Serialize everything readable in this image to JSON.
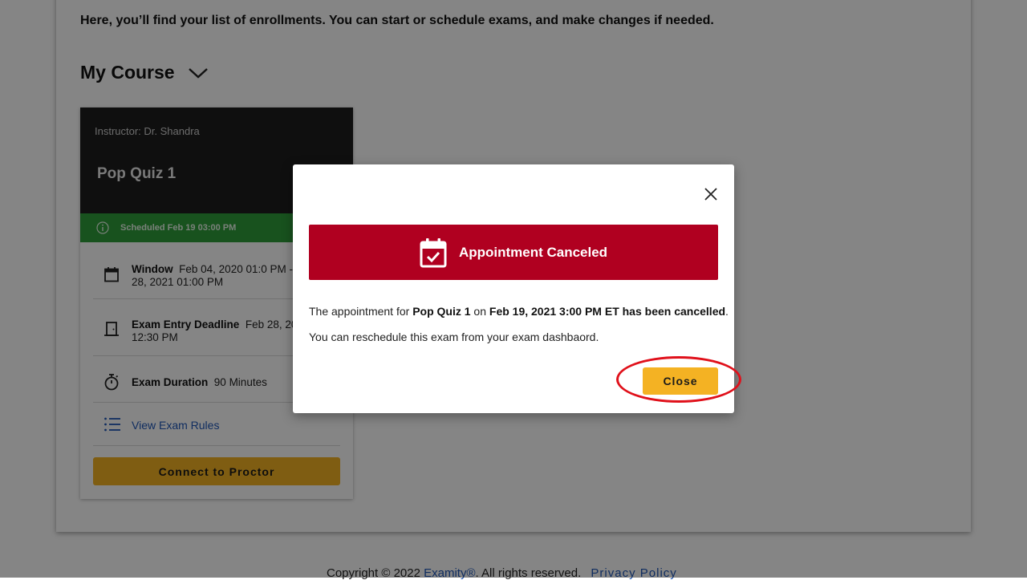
{
  "page": {
    "intro": "Here, you’ll find your list of enrollments. You can start or schedule exams, and make changes if needed.",
    "course_title": "My Course"
  },
  "exam_card": {
    "instructor": "Instructor: Dr. Shandra",
    "exam_name": "Pop Quiz 1",
    "status": "Scheduled Feb 19 03:00 PM",
    "window_label": "Window",
    "window_value_1": "Feb 04, 2020 01:0 PM -",
    "window_value_2": "28, 2021 01:00 PM",
    "deadline_label": "Exam Entry Deadline",
    "deadline_value_1": "Feb 28, 20",
    "deadline_value_2": "12:30 PM",
    "duration_label": "Exam Duration",
    "duration_value": "90 Minutes",
    "rules_link": "View Exam Rules",
    "proctor_button": "Connect to Proctor"
  },
  "footer": {
    "copyright": "Copyright © 2022",
    "brand_link": "Examity®",
    "rights": ". All rights reserved.",
    "privacy_link": "Privacy Policy"
  },
  "modal": {
    "banner_title": "Appointment Canceled",
    "msg_prefix": "The appointment for",
    "msg_exam": "Pop Quiz 1",
    "msg_on": "on",
    "msg_date": "Feb 19, 2021 3:00 PM ET has been cancelled",
    "msg_period": ".",
    "sub_text": "You can reschedule this exam from your exam dashbaord.",
    "close_button": "Close"
  },
  "colors": {
    "banner": "#b00020",
    "accent_button": "#f4b223",
    "status_green": "#2e9e3a",
    "link": "#1f57b8",
    "highlight_ring": "#e0101a"
  },
  "icons": [
    "chevron-down-icon",
    "info-icon",
    "calendar-icon",
    "door-icon",
    "stopwatch-icon",
    "list-icon",
    "close-icon",
    "calendar-check-icon"
  ]
}
